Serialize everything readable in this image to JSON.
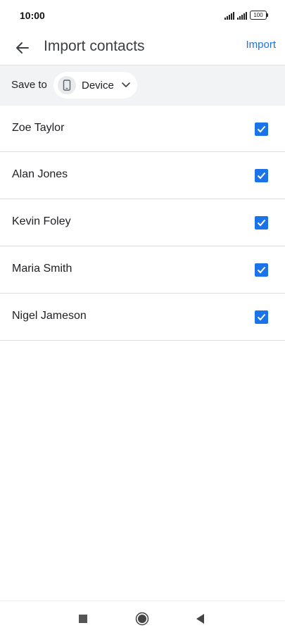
{
  "status_bar": {
    "time": "10:00",
    "battery": "100",
    "icons": [
      "signal-icon",
      "signal-icon",
      "battery-icon"
    ]
  },
  "app_bar": {
    "back_icon": "arrow-back-icon",
    "title": "Import contacts",
    "action_label": "Import"
  },
  "save_to": {
    "label": "Save to",
    "chip_icon": "phone-icon",
    "chip_label": "Device",
    "chip_chevron": "chevron-down-icon"
  },
  "contacts": [
    {
      "name": "Zoe Taylor",
      "checked": true
    },
    {
      "name": "Alan Jones",
      "checked": true
    },
    {
      "name": "Kevin Foley",
      "checked": true
    },
    {
      "name": "Maria Smith",
      "checked": true
    },
    {
      "name": "Nigel Jameson",
      "checked": true
    }
  ],
  "nav_bar": {
    "icons": [
      "recents-square-icon",
      "home-circle-icon",
      "back-triangle-icon"
    ]
  },
  "colors": {
    "accent": "#1a73e8",
    "save_bar_bg": "#f1f3f4",
    "divider": "#dadce0"
  }
}
